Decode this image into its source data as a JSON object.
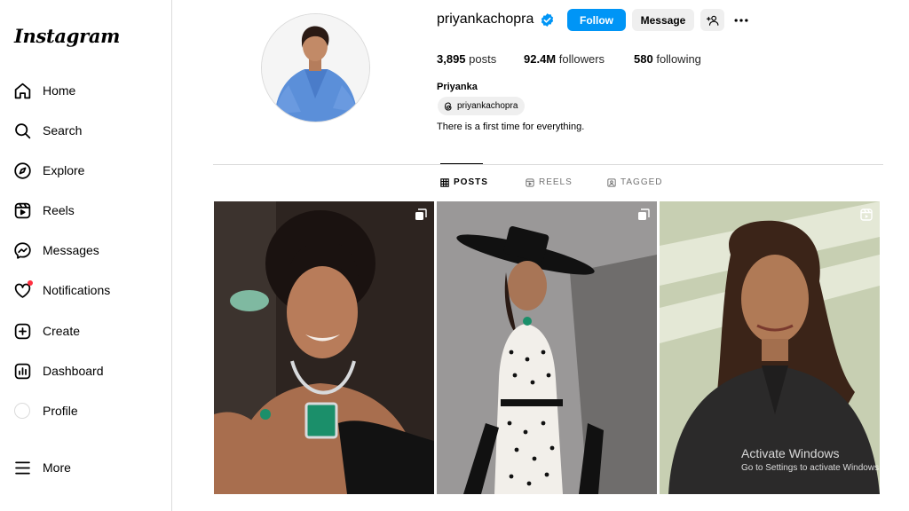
{
  "brand": {
    "logo_text": "Instagram"
  },
  "sidebar": {
    "items": [
      {
        "label": "Home",
        "icon": "home-icon"
      },
      {
        "label": "Search",
        "icon": "search-icon"
      },
      {
        "label": "Explore",
        "icon": "compass-icon"
      },
      {
        "label": "Reels",
        "icon": "reels-icon"
      },
      {
        "label": "Messages",
        "icon": "messenger-icon"
      },
      {
        "label": "Notifications",
        "icon": "heart-icon"
      },
      {
        "label": "Create",
        "icon": "plus-square-icon"
      },
      {
        "label": "Dashboard",
        "icon": "bar-chart-icon"
      },
      {
        "label": "Profile",
        "icon": "avatar-icon"
      },
      {
        "label": "More",
        "icon": "hamburger-icon"
      }
    ]
  },
  "profile": {
    "username": "priyankachopra",
    "verified": true,
    "follow_label": "Follow",
    "message_label": "Message",
    "stats": {
      "posts_count": "3,895",
      "posts_label": "posts",
      "followers_count": "92.4M",
      "followers_label": "followers",
      "following_count": "580",
      "following_label": "following"
    },
    "full_name": "Priyanka",
    "threads_handle": "priyankachopra",
    "bio": "There is a first time for everything."
  },
  "tabs": [
    {
      "label": "POSTS",
      "active": true
    },
    {
      "label": "REELS",
      "active": false
    },
    {
      "label": "TAGGED",
      "active": false
    }
  ],
  "posts": [
    {
      "type": "carousel"
    },
    {
      "type": "carousel"
    },
    {
      "type": "reel"
    }
  ],
  "watermark": {
    "line1": "Activate Windows",
    "line2": "Go to Settings to activate Windows."
  },
  "colors": {
    "accent": "#0095f6",
    "button_bg": "#efefef",
    "notification_dot": "#ff3040",
    "divider": "#dbdbdb"
  }
}
